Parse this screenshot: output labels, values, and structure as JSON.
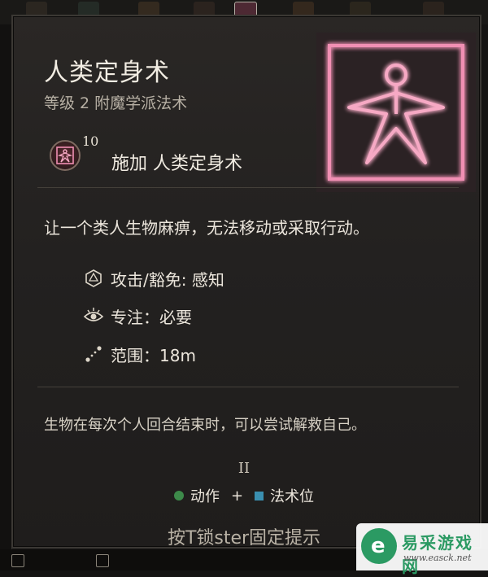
{
  "spell": {
    "name": "人类定身术",
    "subtitle": "等级 2 附魔学派法术",
    "cast_level": "10",
    "cast_label": "施加 人类定身术",
    "description": "让一个类人生物麻痹，无法移动或采取行动。",
    "properties": [
      {
        "icon": "d20-icon",
        "text": "攻击/豁免: 感知"
      },
      {
        "icon": "eye-concentration-icon",
        "text": "专注：必要"
      },
      {
        "icon": "range-icon",
        "text": "范围：18m"
      }
    ],
    "note": "生物在每次个人回合结束时，可以尝试解救自己。",
    "tier": "II",
    "cost": {
      "action": "动作",
      "plus": "+",
      "slot": "法术位"
    },
    "hint": "按T锁ster固定提示"
  },
  "colors": {
    "accent_pink": "#f08fb3",
    "action_green": "#3d8a4a",
    "slot_blue": "#3a8fb0"
  },
  "watermark": {
    "logo_letter": "e",
    "brand": "易采游戏网",
    "url": "www.easck.net"
  }
}
